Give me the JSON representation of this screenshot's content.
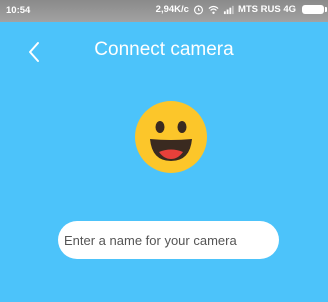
{
  "status_bar": {
    "time": "10:54",
    "network_speed": "2,94K/c",
    "carrier": "MTS RUS 4G",
    "icons": [
      "alarm-icon",
      "wifi-icon",
      "signal-icon",
      "battery-icon"
    ]
  },
  "header": {
    "title": "Connect camera",
    "back_icon": "chevron-left-icon"
  },
  "main": {
    "illustration": "smiling-face-icon",
    "name_input": {
      "placeholder": "Enter a name for your camera",
      "value": ""
    }
  },
  "colors": {
    "background": "#4cc3fa",
    "status_bar": "#959595",
    "emoji_face": "#fcc62a",
    "emoji_features": "#3a2a20"
  }
}
